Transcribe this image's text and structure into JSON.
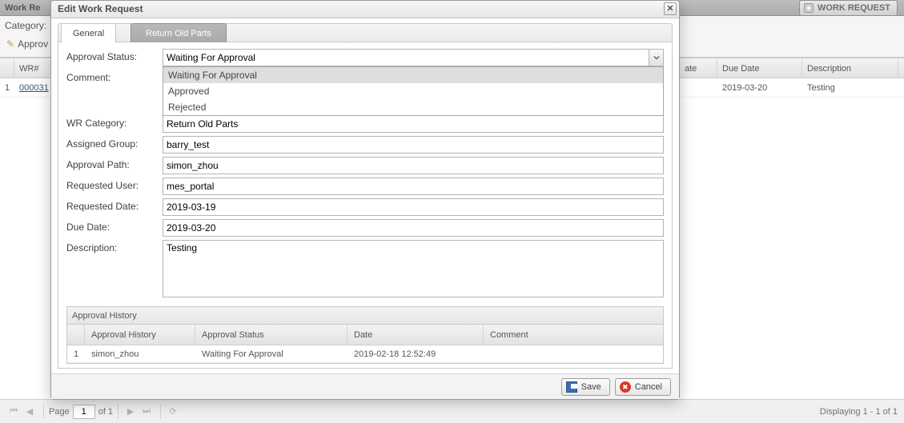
{
  "bg": {
    "header_title": "Work Re",
    "work_request_btn": "WORK REQUEST",
    "toolbar_category_label": "Category:",
    "toolbar_approve_label": "Approv",
    "columns": {
      "idx": "",
      "wr": "WR#",
      "date": "ate",
      "due": "Due Date",
      "desc": "Description"
    },
    "row": {
      "idx": "1",
      "wr": "000031",
      "due": "2019-03-20",
      "desc": "Testing"
    }
  },
  "paging": {
    "page_label": "Page",
    "page_value": "1",
    "of_label": "of 1",
    "display": "Displaying 1 - 1 of 1"
  },
  "dialog": {
    "title": "Edit Work Request",
    "tabs": {
      "general": "General",
      "return": "Return Old Parts"
    },
    "labels": {
      "approval_status": "Approval Status:",
      "comment": "Comment:",
      "wr_category": "WR Category:",
      "assigned_group": "Assigned Group:",
      "approval_path": "Approval Path:",
      "requested_user": "Requested User:",
      "requested_date": "Requested Date:",
      "due_date": "Due Date:",
      "description": "Description:"
    },
    "values": {
      "approval_status": "Waiting For Approval",
      "comment": "",
      "wr_category": "Return Old Parts",
      "assigned_group": "barry_test",
      "approval_path": "simon_zhou",
      "requested_user": "mes_portal",
      "requested_date": "2019-03-19",
      "due_date": "2019-03-20",
      "description": "Testing"
    },
    "status_options": [
      "Waiting For Approval",
      "Approved",
      "Rejected"
    ],
    "history": {
      "panel_title": "Approval History",
      "columns": {
        "hist": "Approval History",
        "status": "Approval Status",
        "date": "Date",
        "comment": "Comment"
      },
      "rows": [
        {
          "idx": "1",
          "hist": "simon_zhou",
          "status": "Waiting For Approval",
          "date": "2019-02-18 12:52:49",
          "comment": ""
        }
      ]
    },
    "buttons": {
      "save": "Save",
      "cancel": "Cancel"
    }
  }
}
